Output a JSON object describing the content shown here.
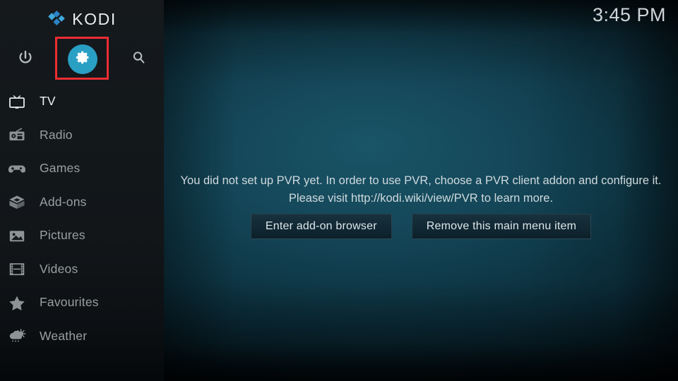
{
  "app": {
    "brand_name": "KODI",
    "logo_icon": "kodi-diamond-logo",
    "accent_color": "#2a9fc4",
    "annotation_color": "#ec2d32"
  },
  "header": {
    "clock": "3:45 PM"
  },
  "sidebar": {
    "top_icons": [
      {
        "name": "power-icon",
        "label": "Power"
      },
      {
        "name": "gear-icon",
        "label": "Settings",
        "highlighted": true
      },
      {
        "name": "search-icon",
        "label": "Search"
      }
    ],
    "items": [
      {
        "label": "TV",
        "icon": "tv-icon",
        "active": true
      },
      {
        "label": "Radio",
        "icon": "radio-icon",
        "active": false
      },
      {
        "label": "Games",
        "icon": "gamepad-icon",
        "active": false
      },
      {
        "label": "Add-ons",
        "icon": "open-box-icon",
        "active": false
      },
      {
        "label": "Pictures",
        "icon": "picture-icon",
        "active": false
      },
      {
        "label": "Videos",
        "icon": "film-strip-icon",
        "active": false
      },
      {
        "label": "Favourites",
        "icon": "star-icon",
        "active": false
      },
      {
        "label": "Weather",
        "icon": "cloud-sun-rain-icon",
        "active": false
      }
    ]
  },
  "main": {
    "message": "You did not set up PVR yet. In order to use PVR, choose a PVR client addon and configure it. Please visit http://kodi.wiki/view/PVR to learn more.",
    "buttons": [
      {
        "label": "Enter add-on browser"
      },
      {
        "label": "Remove this main menu item"
      }
    ]
  }
}
